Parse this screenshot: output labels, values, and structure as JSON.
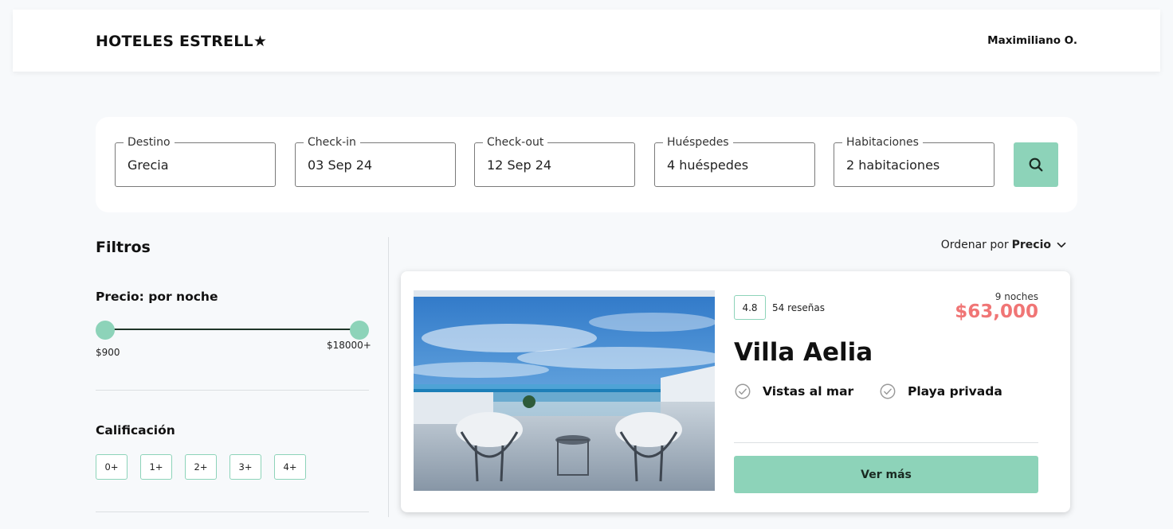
{
  "header": {
    "logo": "HOTELES ESTRELL★",
    "user_name": "Maximiliano O."
  },
  "search": {
    "fields": [
      {
        "label": "Destino",
        "value": "Grecia"
      },
      {
        "label": "Check-in",
        "value": "03 Sep 24"
      },
      {
        "label": "Check-out",
        "value": "12 Sep 24"
      },
      {
        "label": "Huéspedes",
        "value": "4 huéspedes"
      },
      {
        "label": "Habitaciones",
        "value": "2 habitaciones"
      }
    ],
    "button_icon": "search-icon"
  },
  "filters": {
    "title": "Filtros",
    "price": {
      "title": "Precio: por noche",
      "min_label": "$900",
      "max_label": "$18000+",
      "selected_min_fraction": 0,
      "selected_max_fraction": 1
    },
    "rating": {
      "title": "Calificación",
      "options": [
        "0+",
        "1+",
        "2+",
        "3+",
        "4+"
      ]
    }
  },
  "sort": {
    "prefix": "Ordenar por",
    "value": "Precio",
    "icon": "chevron-down-icon"
  },
  "results": [
    {
      "score": "4.8",
      "reviews": "54 reseñas",
      "nights": "9 noches",
      "price": "$63,000",
      "name": "Villa Aelia",
      "amenities": [
        "Vistas al mar",
        "Playa privada"
      ],
      "button_label": "Ver más"
    }
  ],
  "colors": {
    "accent": "#8dd3b9",
    "price": "#f07575",
    "background": "#f7f9fb"
  }
}
